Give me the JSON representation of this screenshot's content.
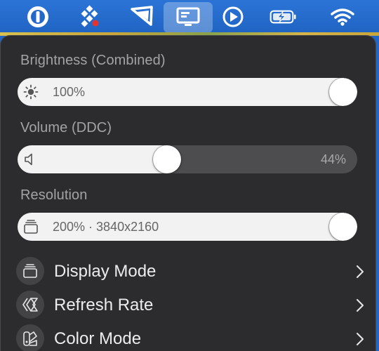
{
  "menubar": {
    "icons": [
      {
        "name": "power-ring-icon"
      },
      {
        "name": "dots-pattern-icon"
      },
      {
        "name": "pennant-icon"
      },
      {
        "name": "display-icon",
        "active": true
      },
      {
        "name": "play-circle-icon"
      },
      {
        "name": "battery-charging-icon"
      },
      {
        "name": "wifi-icon"
      }
    ],
    "accent": "#1f63c2"
  },
  "panel": {
    "brightness": {
      "label": "Brightness (Combined)",
      "value_text": "100%",
      "level": 1.0
    },
    "volume": {
      "label": "Volume (DDC)",
      "value_text": "44%",
      "level": 0.44
    },
    "resolution": {
      "label": "Resolution",
      "value_text": "200% · 3840x2160",
      "level": 1.0
    },
    "items": [
      {
        "label": "Display Mode",
        "icon": "stacked-display-icon"
      },
      {
        "label": "Refresh Rate",
        "icon": "refresh-rate-icon"
      },
      {
        "label": "Color Mode",
        "icon": "palette-icon"
      }
    ]
  },
  "colors": {
    "panel_bg": "#2c2c2e",
    "slider_fill": "#f2f2f2",
    "slider_track": "#4d4d50",
    "label_text": "#a3a3a6"
  }
}
